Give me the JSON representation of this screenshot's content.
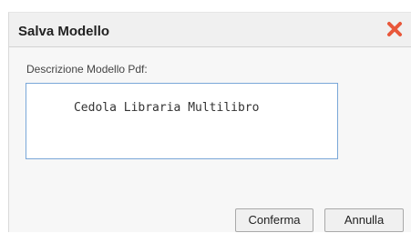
{
  "dialog": {
    "title": "Salva Modello",
    "close_icon": "close-x-icon",
    "close_color": "#e8573a"
  },
  "form": {
    "label": "Descrizione Modello Pdf:",
    "value": "Cedola Libraria Multilibro"
  },
  "buttons": {
    "confirm_label": "Conferma",
    "cancel_label": "Annulla"
  }
}
